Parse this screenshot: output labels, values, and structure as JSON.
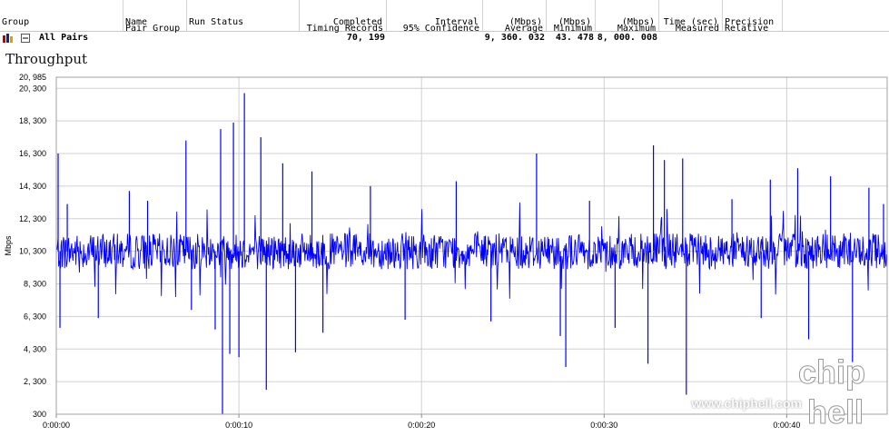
{
  "table": {
    "headers": [
      {
        "line1": "",
        "line2": "Group"
      },
      {
        "line1": "Pair Group",
        "line2": "Name"
      },
      {
        "line1": "",
        "line2": "Run Status"
      },
      {
        "line1": "Timing Records",
        "line2": "Completed"
      },
      {
        "line1": "95% Confidence",
        "line2": "Interval"
      },
      {
        "line1": "Average",
        "line2": "(Mbps)"
      },
      {
        "line1": "Minimum",
        "line2": "(Mbps)"
      },
      {
        "line1": "Maximum",
        "line2": "(Mbps)"
      },
      {
        "line1": "Measured",
        "line2": "Time (sec)"
      },
      {
        "line1": "Relative",
        "line2": "Precision"
      }
    ],
    "row": {
      "group": "All Pairs",
      "timing_records": "70, 199",
      "average": "9, 360. 032",
      "minimum": "43. 478",
      "maximum": "8, 000. 008"
    }
  },
  "chart_title": "Throughput",
  "chart_data": {
    "type": "line",
    "title": "Throughput",
    "ylabel": "Mbps",
    "xlabel": "",
    "ylim": [
      300,
      20985
    ],
    "xlim_seconds": [
      0,
      45.5
    ],
    "y_ticks": [
      "20, 985",
      "20, 300",
      "18, 300",
      "16, 300",
      "14, 300",
      "12, 300",
      "10, 300",
      "8, 300",
      "6, 300",
      "4, 300",
      "2, 300",
      "300"
    ],
    "x_ticks": [
      "0:00:00",
      "0:00:10",
      "0:00:20",
      "0:00:30",
      "0:00:40"
    ],
    "grid": true,
    "series": [
      {
        "color": "#0000ff",
        "baseline_mbps": 10300,
        "noise_band_mbps": [
          9300,
          11300
        ],
        "spikes": [
          {
            "t": 0.1,
            "v": 16300
          },
          {
            "t": 0.2,
            "v": 5600
          },
          {
            "t": 0.6,
            "v": 13200
          },
          {
            "t": 2.3,
            "v": 6200
          },
          {
            "t": 4.0,
            "v": 14000
          },
          {
            "t": 5.0,
            "v": 13400
          },
          {
            "t": 7.1,
            "v": 17100
          },
          {
            "t": 7.4,
            "v": 6700
          },
          {
            "t": 8.7,
            "v": 5500
          },
          {
            "t": 9.0,
            "v": 17800
          },
          {
            "t": 9.1,
            "v": 300
          },
          {
            "t": 9.5,
            "v": 4000
          },
          {
            "t": 9.7,
            "v": 18200
          },
          {
            "t": 10.0,
            "v": 3800
          },
          {
            "t": 10.3,
            "v": 20000
          },
          {
            "t": 11.2,
            "v": 17300
          },
          {
            "t": 11.5,
            "v": 1800
          },
          {
            "t": 12.4,
            "v": 15700
          },
          {
            "t": 13.1,
            "v": 4100
          },
          {
            "t": 14.0,
            "v": 15200
          },
          {
            "t": 14.6,
            "v": 5300
          },
          {
            "t": 17.2,
            "v": 14300
          },
          {
            "t": 19.1,
            "v": 6100
          },
          {
            "t": 21.9,
            "v": 14600
          },
          {
            "t": 23.8,
            "v": 6000
          },
          {
            "t": 26.3,
            "v": 16300
          },
          {
            "t": 27.6,
            "v": 5100
          },
          {
            "t": 27.9,
            "v": 3200
          },
          {
            "t": 29.2,
            "v": 13400
          },
          {
            "t": 30.6,
            "v": 5600
          },
          {
            "t": 32.4,
            "v": 3400
          },
          {
            "t": 32.7,
            "v": 16800
          },
          {
            "t": 33.3,
            "v": 15900
          },
          {
            "t": 34.3,
            "v": 16000
          },
          {
            "t": 34.5,
            "v": 1500
          },
          {
            "t": 37.0,
            "v": 13500
          },
          {
            "t": 38.6,
            "v": 6200
          },
          {
            "t": 39.1,
            "v": 14700
          },
          {
            "t": 40.6,
            "v": 15400
          },
          {
            "t": 41.2,
            "v": 4900
          },
          {
            "t": 42.4,
            "v": 14900
          },
          {
            "t": 43.6,
            "v": 3500
          },
          {
            "t": 44.5,
            "v": 14200
          },
          {
            "t": 45.3,
            "v": 13200
          }
        ]
      }
    ]
  },
  "watermark": {
    "url": "www.chiphell.com",
    "logo_text": "chip hell"
  }
}
